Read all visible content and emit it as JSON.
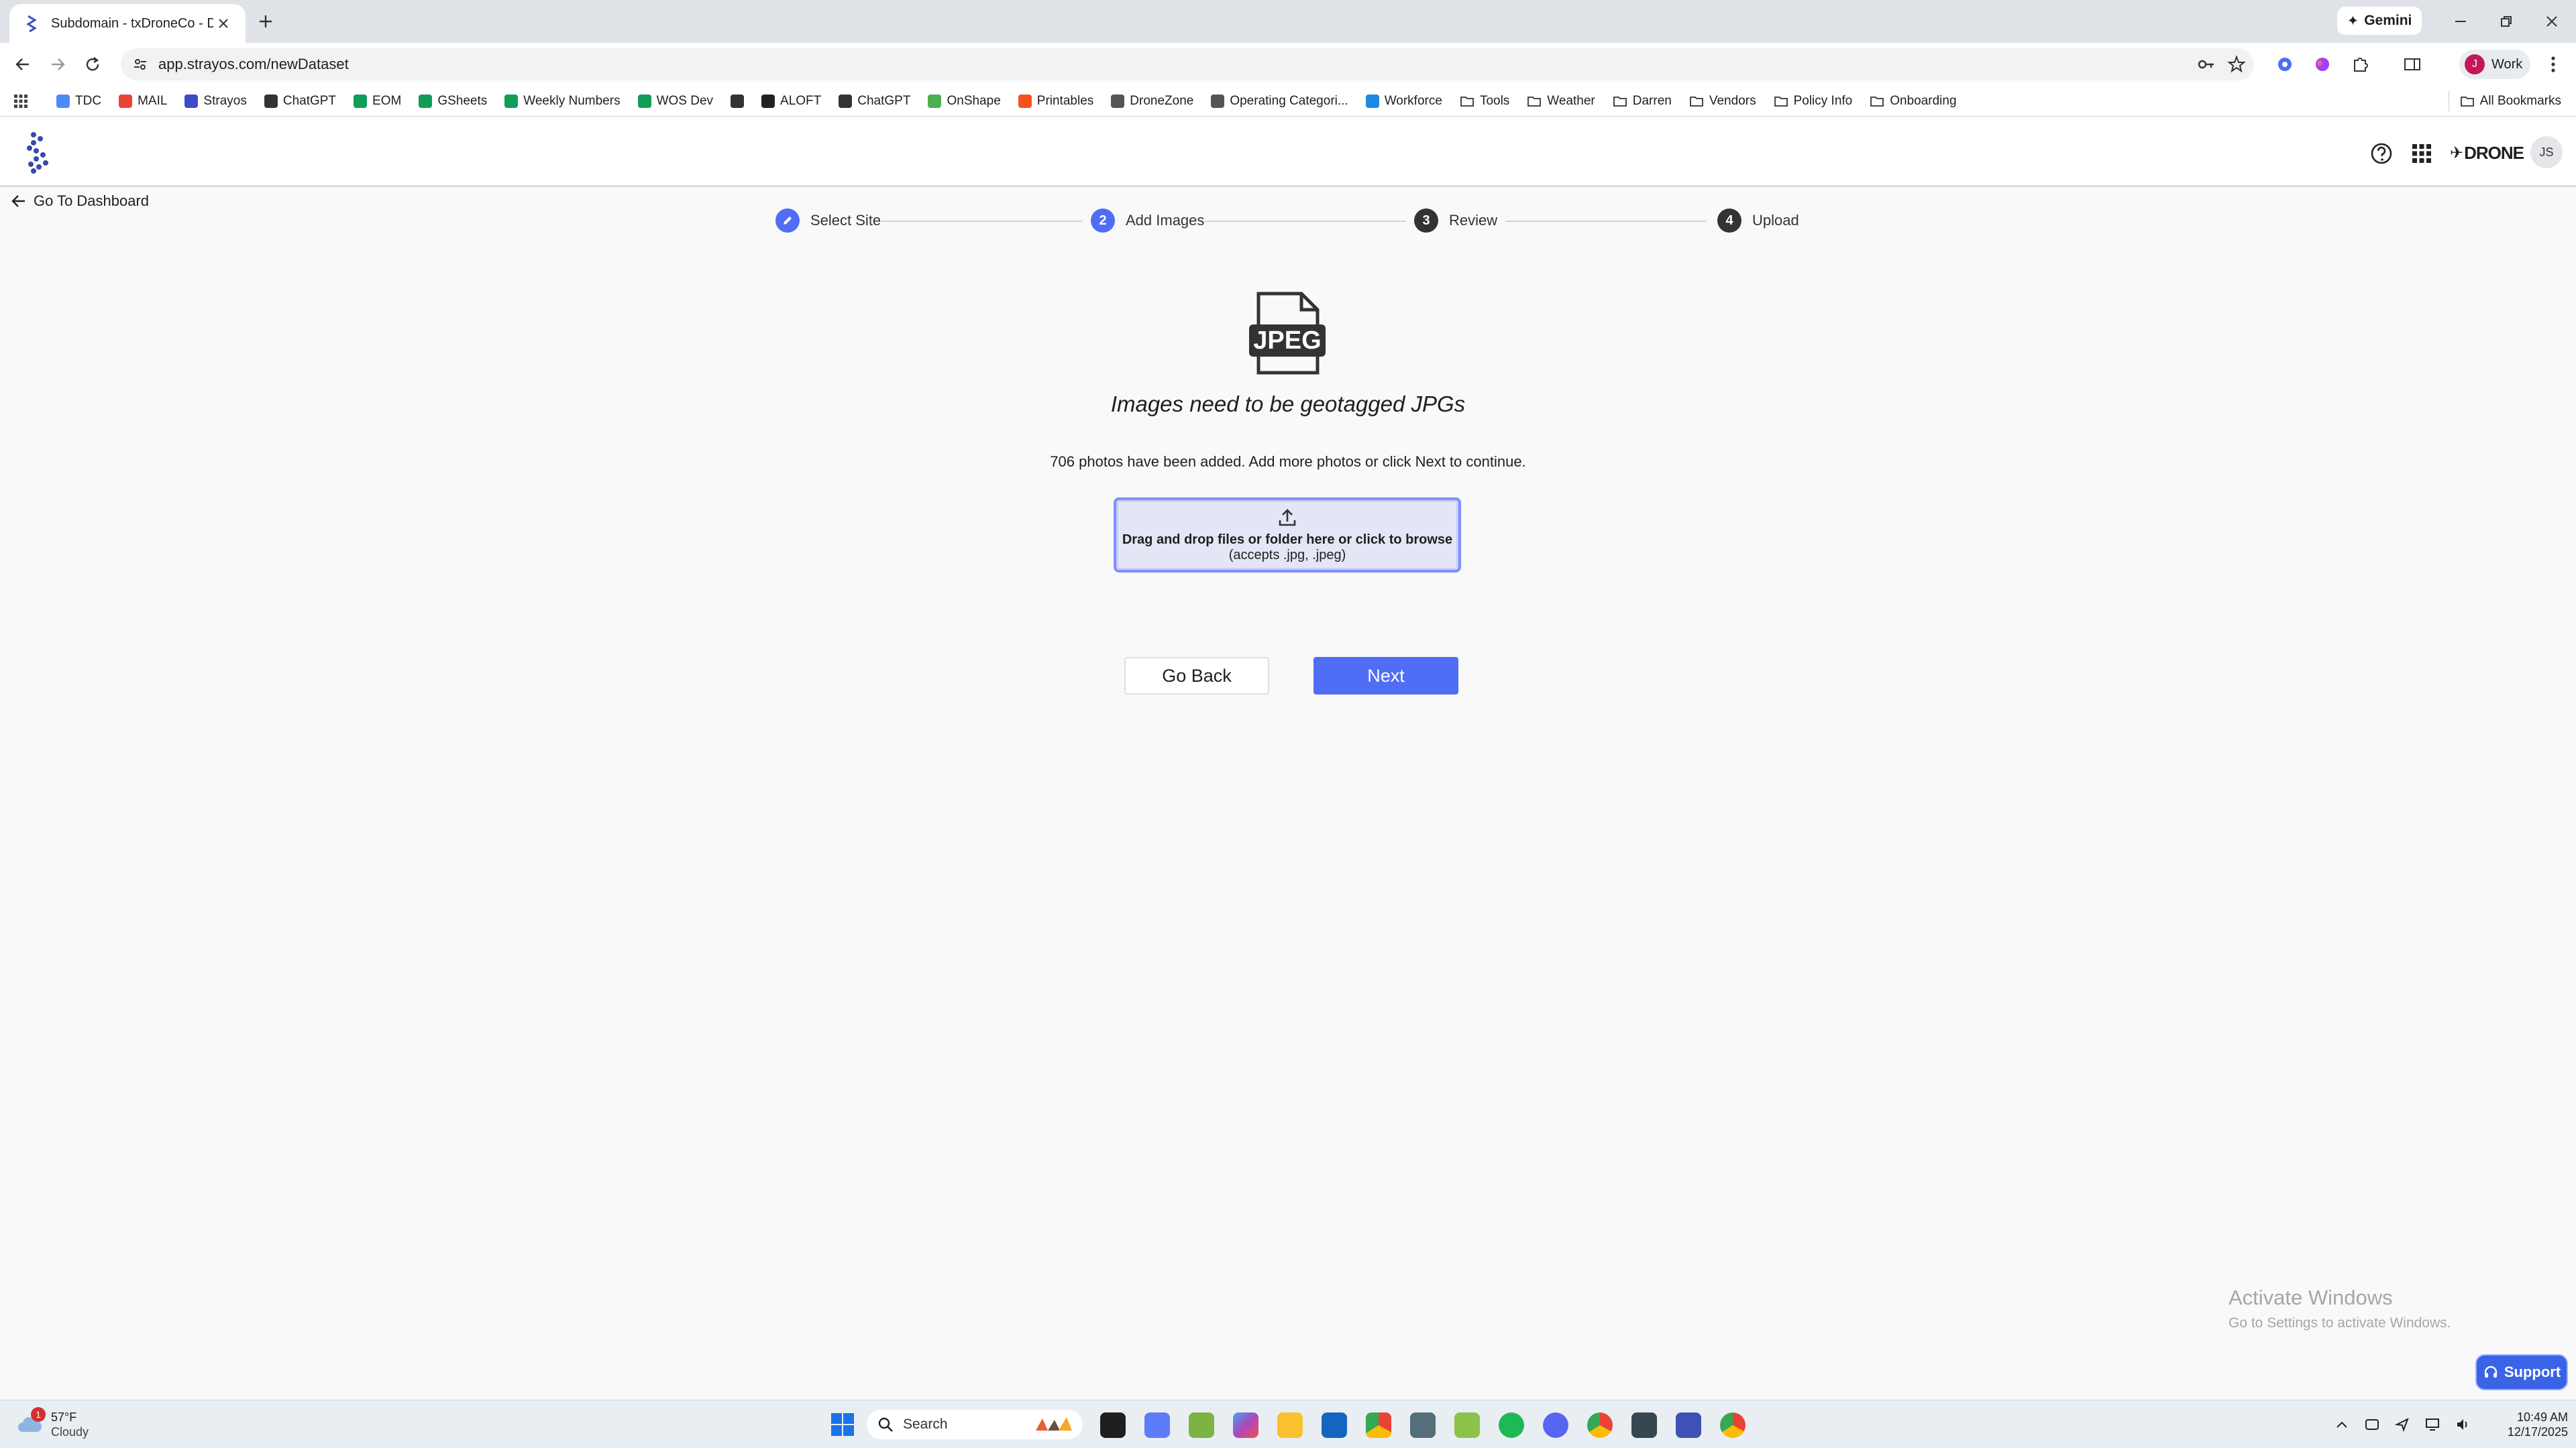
{
  "browser": {
    "tab_title": "Subdomain - txDroneCo - Dem",
    "url": "app.strayos.com/newDataset",
    "gemini_label": "Gemini",
    "profile_label": "Work",
    "profile_initial": "J"
  },
  "bookmarks": {
    "items": [
      {
        "label": "TDC",
        "color": "#4c8bf5"
      },
      {
        "label": "MAIL",
        "color": "#ea4335"
      },
      {
        "label": "Strayos",
        "color": "#3c4cc8"
      },
      {
        "label": "ChatGPT",
        "color": "#333333"
      },
      {
        "label": "EOM",
        "color": "#0f9d58"
      },
      {
        "label": "GSheets",
        "color": "#0f9d58"
      },
      {
        "label": "Weekly Numbers",
        "color": "#0f9d58"
      },
      {
        "label": "WOS Dev",
        "color": "#0f9d58"
      },
      {
        "label": "",
        "color": "#333333"
      },
      {
        "label": "ALOFT",
        "color": "#222222"
      },
      {
        "label": "ChatGPT",
        "color": "#333333"
      },
      {
        "label": "OnShape",
        "color": "#4caf50"
      },
      {
        "label": "Printables",
        "color": "#f4511e"
      },
      {
        "label": "DroneZone",
        "color": "#555555"
      },
      {
        "label": "Operating Categori...",
        "color": "#555555"
      },
      {
        "label": "Workforce",
        "color": "#1e88e5"
      },
      {
        "label": "Tools",
        "color": "folder"
      },
      {
        "label": "Weather",
        "color": "folder"
      },
      {
        "label": "Darren",
        "color": "folder"
      },
      {
        "label": "Vendors",
        "color": "folder"
      },
      {
        "label": "Policy Info",
        "color": "folder"
      },
      {
        "label": "Onboarding",
        "color": "folder"
      }
    ],
    "all_label": "All Bookmarks"
  },
  "header": {
    "brand_text": "DRONE",
    "user_initials": "JS"
  },
  "nav": {
    "back_label": "Go To Dashboard"
  },
  "stepper": {
    "steps": [
      {
        "number": "",
        "label": "Select Site",
        "state": "complete"
      },
      {
        "number": "2",
        "label": "Add Images",
        "state": "active"
      },
      {
        "number": "3",
        "label": "Review",
        "state": "pending"
      },
      {
        "number": "4",
        "label": "Upload",
        "state": "pending"
      }
    ]
  },
  "main": {
    "icon_text": "JPEG",
    "headline": "Images need to be geotagged JPGs",
    "status": "706 photos have been added. Add more photos or click Next to continue.",
    "dropzone_main": "Drag and drop files or folder here or click to browse",
    "dropzone_sub": "(accepts .jpg, .jpeg)",
    "back_button": "Go Back",
    "next_button": "Next"
  },
  "watermark": {
    "title": "Activate Windows",
    "subtitle": "Go to Settings to activate Windows."
  },
  "support_label": "Support",
  "taskbar": {
    "temperature": "57°F",
    "condition": "Cloudy",
    "weather_badge": "1",
    "search_label": "Search",
    "time": "10:49 AM",
    "date": "12/17/2025"
  },
  "colors": {
    "accent": "#4f6df5",
    "step_done": "#4f6df5",
    "step_pending": "#333333",
    "dropzone_border": "#7f8fff"
  }
}
